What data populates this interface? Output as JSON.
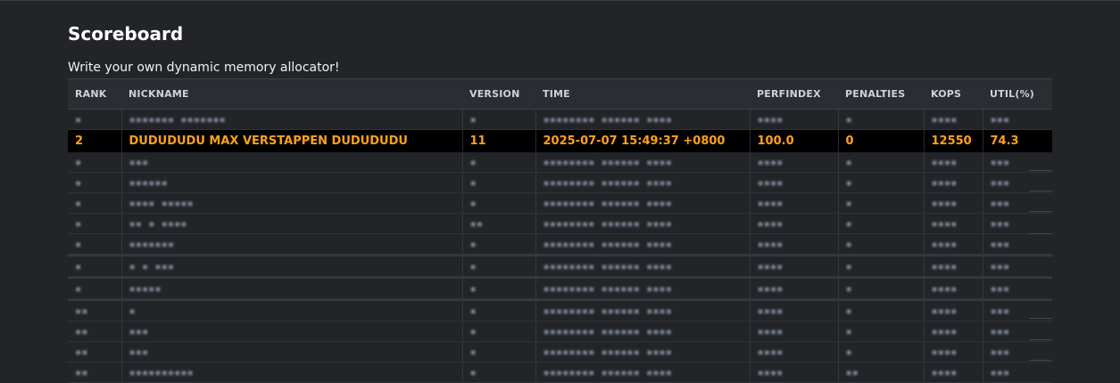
{
  "page": {
    "title": "Scoreboard",
    "subtitle": "Write your own dynamic memory allocator!"
  },
  "table": {
    "headers": [
      "RANK",
      "NICKNAME",
      "VERSION",
      "TIME",
      "PERFINDEX",
      "PENALTIES",
      "KOPS",
      "UTIL(%)"
    ],
    "highlight": {
      "rank": "2",
      "nickname": "DUDUDUDU MAX VERSTAPPEN DUDUDUDU",
      "version": "11",
      "time": "2025-07-07 15:49:37 +0800",
      "perfindex": "100.0",
      "penalties": "0",
      "kops": "12550",
      "util": "74.3"
    }
  },
  "colors": {
    "background": "#222428",
    "highlight_text": "#ffa21a",
    "highlight_bg": "#000000"
  }
}
